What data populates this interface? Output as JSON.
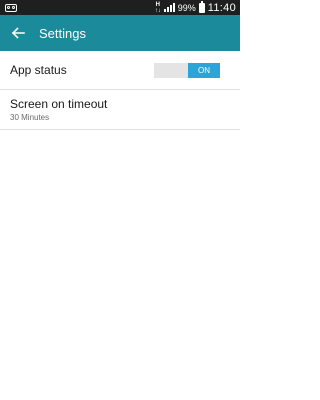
{
  "status_bar": {
    "voicemail_icon": "voicemail-icon",
    "network_type_top": "H",
    "network_type_bottom": "↑↓",
    "battery_percent": "99%",
    "time": "11:40"
  },
  "app_bar": {
    "back_icon": "arrow-left-icon",
    "title": "Settings",
    "color": "#1b8a9a"
  },
  "settings": {
    "app_status": {
      "title": "App status",
      "toggle_label": "ON",
      "toggle_on": true,
      "accent_color": "#2ca4d8"
    },
    "screen_timeout": {
      "title": "Screen on timeout",
      "value": "30 Minutes"
    }
  }
}
